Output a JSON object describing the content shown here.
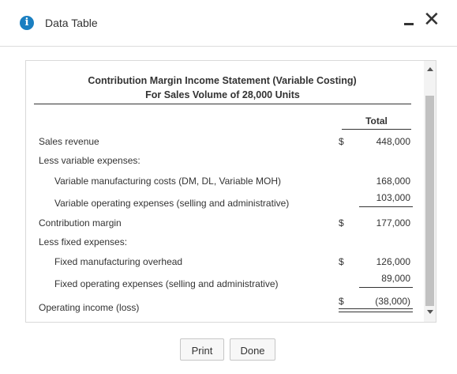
{
  "window": {
    "title": "Data Table",
    "info_icon_glyph": "i",
    "close_glyph": "✕"
  },
  "statement": {
    "title": "Contribution Margin Income Statement (Variable Costing)",
    "subtitle": "For Sales Volume of 28,000 Units",
    "column_header": "Total",
    "rows": [
      {
        "label": "Sales revenue",
        "dollar": "$",
        "amount": "448,000"
      },
      {
        "label": "Less variable expenses:",
        "dollar": "",
        "amount": ""
      },
      {
        "label": "Variable manufacturing costs (DM, DL, Variable MOH)",
        "dollar": "",
        "amount": "168,000"
      },
      {
        "label": "Variable operating expenses (selling and administrative)",
        "dollar": "",
        "amount": "103,000"
      },
      {
        "label": "Contribution margin",
        "dollar": "$",
        "amount": "177,000"
      },
      {
        "label": "Less fixed expenses:",
        "dollar": "",
        "amount": ""
      },
      {
        "label": "Fixed manufacturing overhead",
        "dollar": "$",
        "amount": "126,000"
      },
      {
        "label": "Fixed operating expenses (selling and administrative)",
        "dollar": "",
        "amount": "89,000"
      },
      {
        "label": "Operating income (loss)",
        "dollar": "$",
        "amount": "(38,000)"
      }
    ]
  },
  "buttons": {
    "print": "Print",
    "done": "Done"
  },
  "colors": {
    "info_icon": "#1a7fc1",
    "text": "#333333",
    "scroll_thumb": "#c1c1c1"
  }
}
